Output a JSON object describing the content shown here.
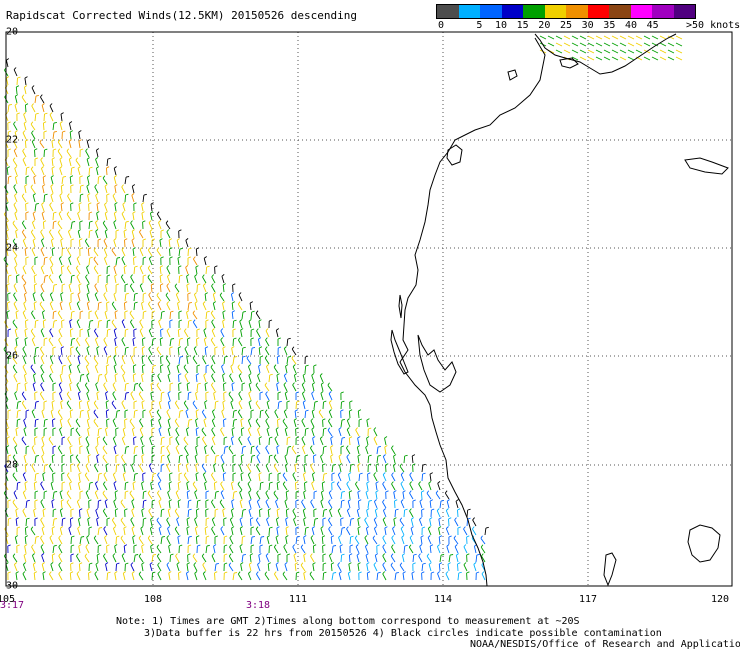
{
  "title": "Rapidscat Corrected Winds(12.5KM) 20150526 descending",
  "scale": {
    "labels": [
      "0",
      "5",
      "10",
      "15",
      "20",
      "25",
      "30",
      "35",
      "40",
      "45",
      ">50 knots"
    ],
    "colors": [
      "#4d4d4d",
      "#00b0ff",
      "#0064ff",
      "#0000c8",
      "#00a000",
      "#f0d000",
      "#f09000",
      "#ff0000",
      "#8b4513",
      "#ff00ff",
      "#a000c0",
      "#500080"
    ]
  },
  "lat_labels": [
    "20",
    "22",
    "24",
    "26",
    "28",
    "30"
  ],
  "lon_labels": [
    "105",
    "108",
    "111",
    "114",
    "117",
    "120"
  ],
  "time_labels": [
    "3:17",
    "3:18"
  ],
  "notes": {
    "line1": "Note: 1) Times are GMT 2)Times along bottom correspond to measurement at ~20S",
    "line2": "3)Data buffer is 22 hrs from 20150526 4) Black circles indicate possible contamination",
    "line3": "NOAA/NESDIS/Office of Research and Applications"
  },
  "map": {
    "grid_style": "dotted",
    "coastline_color": "#000000",
    "swath_edge_color": "#000000"
  }
}
